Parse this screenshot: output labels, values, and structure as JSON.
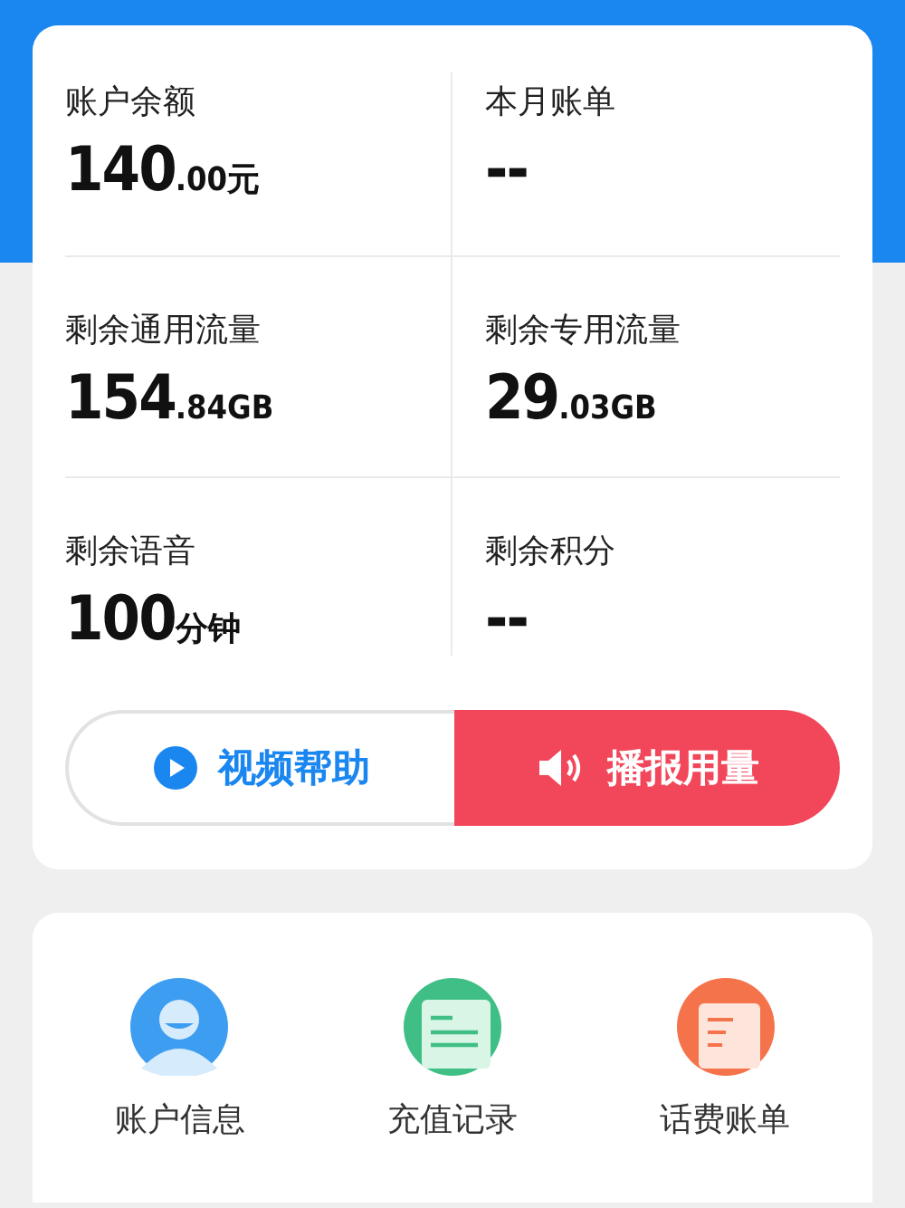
{
  "stats": [
    {
      "label": "账户余额",
      "value": "140",
      "unit": ".00元"
    },
    {
      "label": "本月账单",
      "value": "--"
    },
    {
      "label": "剩余通用流量",
      "value": "154",
      "unit": ".84GB"
    },
    {
      "label": "剩余专用流量",
      "value": "29",
      "unit": ".03GB"
    },
    {
      "label": "剩余语音",
      "value": "100",
      "unit": "分钟"
    },
    {
      "label": "剩余积分",
      "value": "--"
    }
  ],
  "actions": [
    {
      "kind": "outline",
      "label": "视频帮助"
    },
    {
      "kind": "filled",
      "label": "播报用量"
    }
  ],
  "shortcuts": [
    {
      "color": "#3d9df0",
      "label": "账户信息"
    },
    {
      "color": "#3fbf85",
      "label": "充值记录"
    },
    {
      "color": "#f5734a",
      "label": "话费账单"
    }
  ]
}
